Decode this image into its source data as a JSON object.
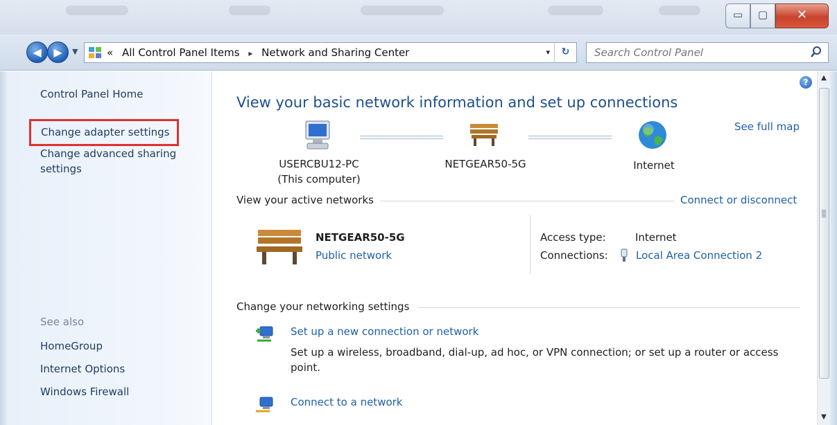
{
  "window": {
    "min_glyph": "▭",
    "max_glyph": "▢",
    "close_glyph": "✕"
  },
  "address_bar": {
    "overflow": "«",
    "crumbs": [
      "All Control Panel Items",
      "Network and Sharing Center"
    ],
    "separator": "▸",
    "dropdown": "▾",
    "refresh": "↻"
  },
  "search": {
    "placeholder": "Search Control Panel"
  },
  "sidebar": {
    "home": "Control Panel Home",
    "change_adapter": "Change adapter settings",
    "change_sharing_line1": "Change advanced sharing",
    "change_sharing_line2": "settings",
    "see_also_label": "See also",
    "see_also": [
      "HomeGroup",
      "Internet Options",
      "Windows Firewall"
    ]
  },
  "main": {
    "heading": "View your basic network information and set up connections",
    "see_full_map": "See full map",
    "map": {
      "computer_name": "USERCBU12-PC",
      "computer_sub": "(This computer)",
      "router_name": "NETGEAR50-5G",
      "internet": "Internet"
    },
    "active_networks": {
      "title": "View your active networks",
      "connect_link": "Connect or disconnect",
      "network_name": "NETGEAR50-5G",
      "network_type": "Public network",
      "access_type_label": "Access type:",
      "access_type_value": "Internet",
      "connections_label": "Connections:",
      "connections_value": "Local Area Connection 2"
    },
    "settings": {
      "title": "Change your networking settings",
      "tasks": [
        {
          "title": "Set up a new connection or network",
          "desc_line1": "Set up a wireless, broadband, dial-up, ad hoc, or VPN connection; or set up a router or access",
          "desc_line2": "point."
        },
        {
          "title": "Connect to a network"
        }
      ]
    }
  },
  "colors": {
    "link": "#1f5fa8",
    "heading": "#1d4f8c",
    "highlight_box": "#e03030"
  }
}
